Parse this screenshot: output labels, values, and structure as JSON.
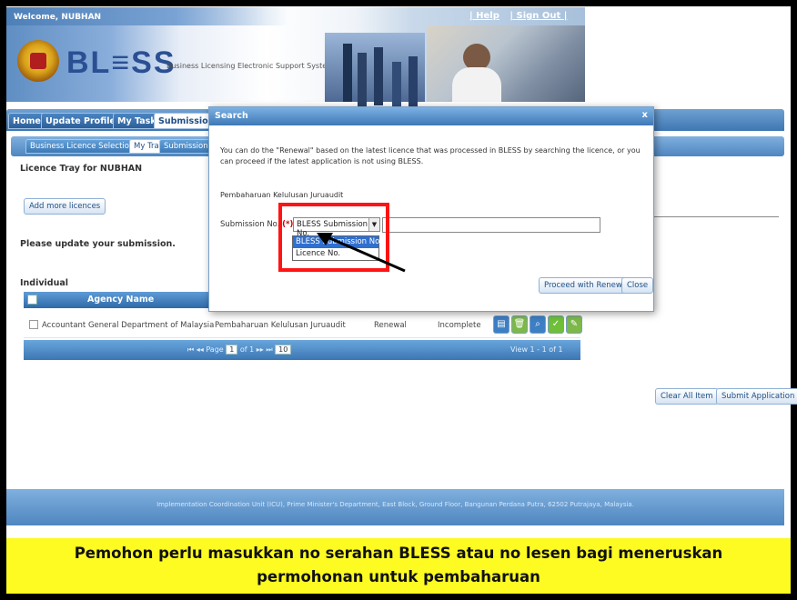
{
  "header": {
    "welcome": "Welcome, NUBHAN",
    "links": [
      "| Help",
      "| Sign Out |"
    ],
    "logo": "BL≡SS",
    "tagline": "Business Licensing Electronic Support System"
  },
  "nav": {
    "tabs": [
      "Home",
      "Update Profile",
      "My Task",
      "Submission"
    ],
    "active": "Submission"
  },
  "subnav": {
    "tabs": [
      "Business Licence Selection",
      "My Tray",
      "Submission A"
    ]
  },
  "tray": {
    "title": "Licence Tray for NUBHAN",
    "add_more": "Add more licences",
    "update_msg": "Please update your submission.",
    "individual": "Individual",
    "column_agency": "Agency Name",
    "row": {
      "agency": "Accountant General Department of Malaysia",
      "service": "Pembaharuan Kelulusan Juruaudit",
      "type": "Renewal",
      "status": "Incomplete"
    },
    "pager": {
      "page_label": "Page",
      "page": "1",
      "of": "of 1",
      "per_page": "10",
      "view": "View 1 - 1 of 1"
    },
    "clear_all": "Clear All Item",
    "submit": "Submit Application"
  },
  "footer": "Implementation Coordination Unit (ICU), Prime Minister's Department, East Block, Ground Floor, Bangunan Perdana Putra, 62502 Putrajaya, Malaysia.",
  "dialog": {
    "title": "Search",
    "close": "x",
    "description": "You can do the \"Renewal\" based on the latest licence that was processed in BLESS by searching the licence, or you can proceed if the latest application is not using BLESS.",
    "service": "Pembaharuan Kelulusan Juruaudit",
    "submission_label": "Submission No.",
    "required_mark": "(*)",
    "selected": "BLESS Submission No.",
    "options": [
      "BLESS Submission No.",
      "Licence No."
    ],
    "proceed": "Proceed with Renewal",
    "close_btn": "Close"
  },
  "caption": {
    "line1": "Pemohon perlu masukkan no serahan BLESS atau no lesen bagi meneruskan",
    "line2": "permohonan untuk pembaharuan"
  },
  "colors": {
    "accent": "#3e78b6",
    "highlight": "#ff1414",
    "caption_bg": "#fdfb22"
  }
}
